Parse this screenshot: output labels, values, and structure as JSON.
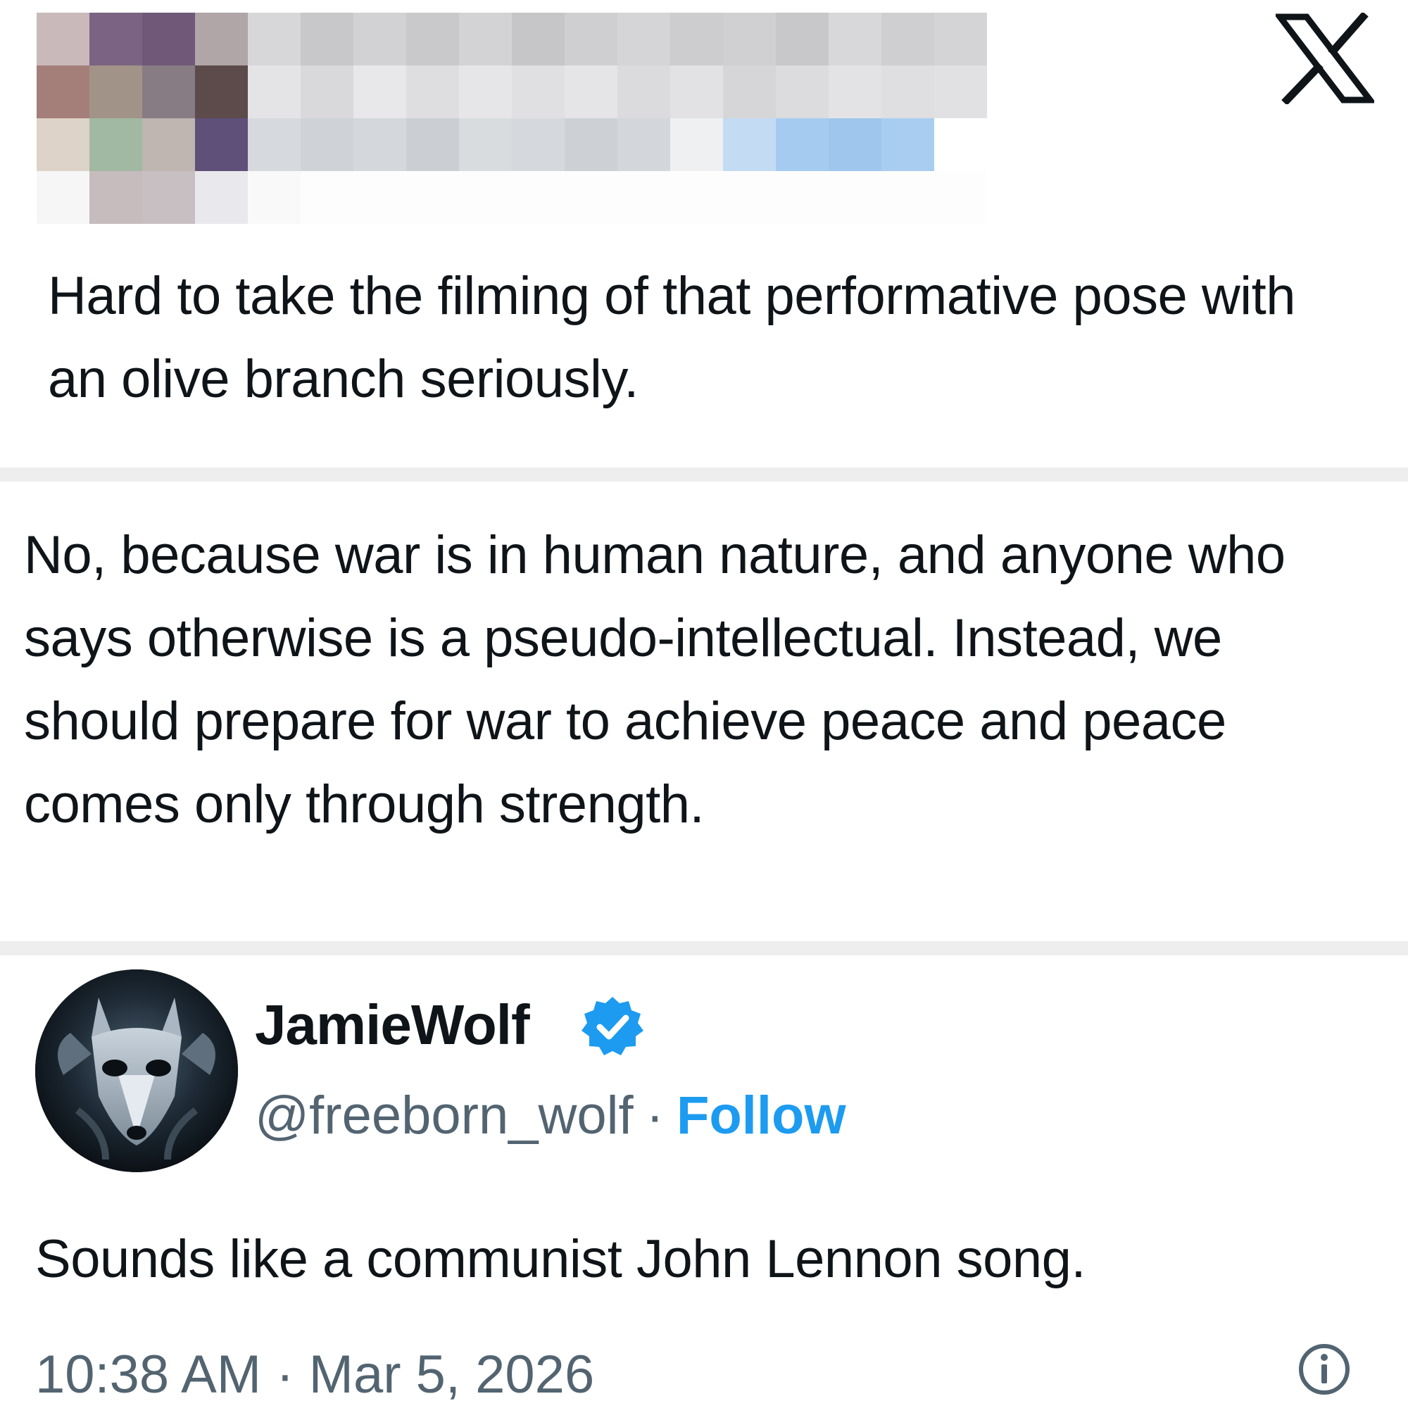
{
  "original_post": {
    "author": "[redacted — pixelated]",
    "text": "Hard to take the filming of that performative pose with an olive branch seriously."
  },
  "brand": {
    "logo_icon": "x-logo-icon"
  },
  "reply_text": "No, because war is in human nature, and anyone who says otherwise is a pseudo-intellectual. Instead, we should prepare for war to achieve peace and peace comes only through strength.",
  "quoted_post": {
    "display_name": "JamieWolf",
    "verified": true,
    "verified_icon": "verified-badge-icon",
    "handle": "@freeborn_wolf",
    "separator": "·",
    "follow_label": "Follow",
    "text": "Sounds like a communist John Lennon song.",
    "timestamp": "10:38 AM · Mar 5, 2026",
    "info_icon": "info-icon"
  },
  "colors": {
    "text_primary": "#0f1419",
    "text_secondary": "#536471",
    "accent": "#1d9bf0",
    "divider": "#eeeeee"
  }
}
